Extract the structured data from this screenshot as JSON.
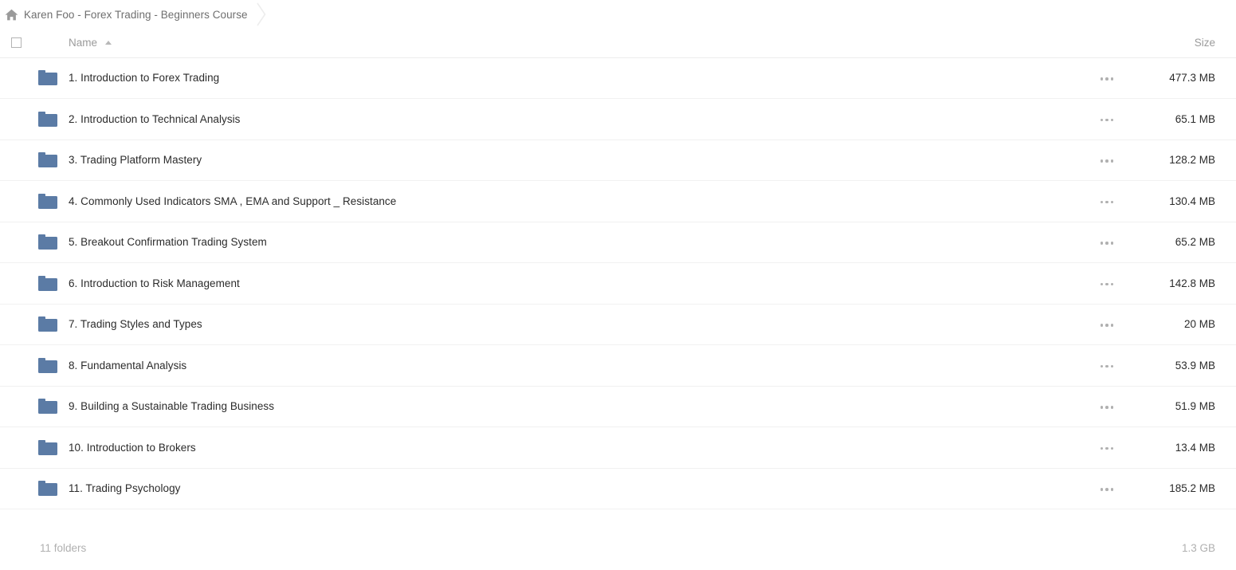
{
  "breadcrumb": {
    "home_icon": "home-icon",
    "path_label": "Karen Foo - Forex Trading - Beginners Course",
    "separator_icon": "chevron-right-icon"
  },
  "table": {
    "headers": {
      "select_all": "",
      "name": "Name",
      "sort_icon": "sort-ascending-icon",
      "size": "Size"
    },
    "rows": [
      {
        "icon": "folder-icon",
        "name": "1. Introduction to Forex Trading",
        "menu": "more-options-icon",
        "size": "477.3 MB"
      },
      {
        "icon": "folder-icon",
        "name": "2. Introduction to Technical Analysis",
        "menu": "more-options-icon",
        "size": "65.1 MB"
      },
      {
        "icon": "folder-icon",
        "name": "3. Trading Platform Mastery",
        "menu": "more-options-icon",
        "size": "128.2 MB"
      },
      {
        "icon": "folder-icon",
        "name": "4. Commonly Used Indicators SMA , EMA and Support _ Resistance",
        "menu": "more-options-icon",
        "size": "130.4 MB"
      },
      {
        "icon": "folder-icon",
        "name": "5. Breakout Confirmation Trading System",
        "menu": "more-options-icon",
        "size": "65.2 MB"
      },
      {
        "icon": "folder-icon",
        "name": "6. Introduction to Risk Management",
        "menu": "more-options-icon",
        "size": "142.8 MB"
      },
      {
        "icon": "folder-icon",
        "name": "7. Trading Styles and Types",
        "menu": "more-options-icon",
        "size": "20 MB"
      },
      {
        "icon": "folder-icon",
        "name": "8. Fundamental Analysis",
        "menu": "more-options-icon",
        "size": "53.9 MB"
      },
      {
        "icon": "folder-icon",
        "name": "9. Building a Sustainable Trading Business",
        "menu": "more-options-icon",
        "size": "51.9 MB"
      },
      {
        "icon": "folder-icon",
        "name": "10. Introduction to Brokers",
        "menu": "more-options-icon",
        "size": "13.4 MB"
      },
      {
        "icon": "folder-icon",
        "name": "11. Trading Psychology",
        "menu": "more-options-icon",
        "size": "185.2 MB"
      }
    ]
  },
  "footer": {
    "item_count": "11 folders",
    "total_size": "1.3 GB"
  },
  "colors": {
    "folder": "#5b7ba5",
    "text": "#2b2b2b",
    "muted": "#9b9b9b",
    "divider": "#f1f1f1",
    "background": "#ffffff"
  }
}
